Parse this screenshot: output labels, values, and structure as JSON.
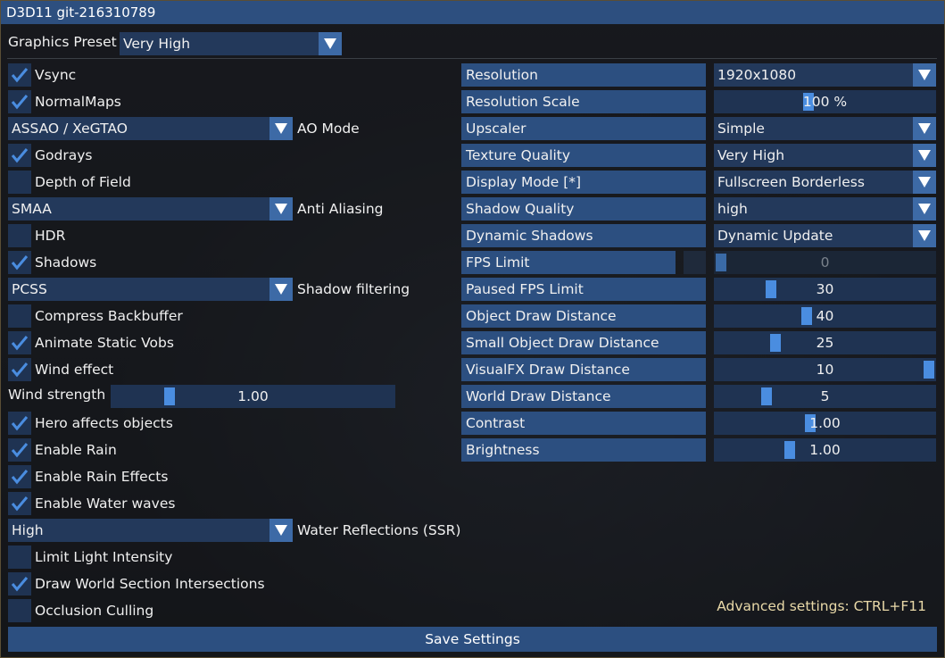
{
  "window": {
    "title": "D3D11 git-216310789"
  },
  "preset": {
    "label": "Graphics Preset",
    "value": "Very High"
  },
  "left": {
    "vsync": "Vsync",
    "normalmaps": "NormalMaps",
    "ao_combo": "ASSAO / XeGTAO",
    "ao_label": "AO Mode",
    "godrays": "Godrays",
    "dof": "Depth of Field",
    "aa_combo": "SMAA",
    "aa_label": "Anti Aliasing",
    "hdr": "HDR",
    "shadows": "Shadows",
    "sf_combo": "PCSS",
    "sf_label": "Shadow filtering",
    "compress": "Compress Backbuffer",
    "animate": "Animate Static Vobs",
    "wind": "Wind effect",
    "wind_strength_label": "Wind strength",
    "wind_strength_value": "1.00",
    "wind_strength_fraction": 0.19,
    "hero": "Hero affects objects",
    "rain": "Enable Rain",
    "rain_effects": "Enable Rain Effects",
    "water_waves": "Enable Water waves",
    "wr_combo": "High",
    "wr_label": "Water Reflections (SSR)",
    "limit_light": "Limit Light Intensity",
    "draw_world": "Draw World Section Intersections",
    "occlusion": "Occlusion Culling"
  },
  "right": {
    "resolution": {
      "label": "Resolution",
      "value": "1920x1080"
    },
    "res_scale": {
      "label": "Resolution Scale",
      "value": "100 %",
      "fraction": 0.42
    },
    "upscaler": {
      "label": "Upscaler",
      "value": "Simple"
    },
    "texture": {
      "label": "Texture Quality",
      "value": "Very High"
    },
    "display": {
      "label": "Display Mode [*]",
      "value": "Fullscreen Borderless"
    },
    "shadow_q": {
      "label": "Shadow Quality",
      "value": "high"
    },
    "dyn_shadows": {
      "label": "Dynamic Shadows",
      "value": "Dynamic Update"
    },
    "fps": {
      "label": "FPS Limit",
      "value": "0",
      "fraction": 0.0
    },
    "paused_fps": {
      "label": "Paused FPS Limit",
      "value": "30",
      "fraction": 0.24
    },
    "object_dd": {
      "label": "Object Draw Distance",
      "value": "40",
      "fraction": 0.41
    },
    "small_dd": {
      "label": "Small Object Draw Distance",
      "value": "25",
      "fraction": 0.26
    },
    "vfx_dd": {
      "label": "VisualFX Draw Distance",
      "value": "10",
      "fraction": 1.0
    },
    "world_dd": {
      "label": "World Draw Distance",
      "value": "5",
      "fraction": 0.22
    },
    "contrast": {
      "label": "Contrast",
      "value": "1.00",
      "fraction": 0.43
    },
    "brightness": {
      "label": "Brightness",
      "value": "1.00",
      "fraction": 0.33
    }
  },
  "hint": "Advanced settings: CTRL+F11",
  "save": "Save Settings"
}
